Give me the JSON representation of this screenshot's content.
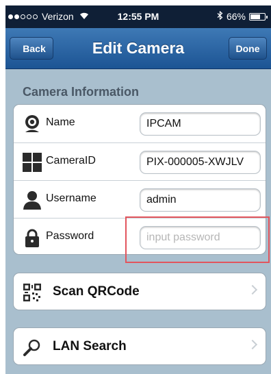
{
  "status_bar": {
    "carrier": "Verizon",
    "time": "12:55 PM",
    "battery": "66%",
    "signal_bars_filled": 2,
    "signal_bars_total": 5
  },
  "nav": {
    "back": "Back",
    "title": "Edit Camera",
    "done": "Done"
  },
  "section": {
    "title": "Camera Information"
  },
  "fields": {
    "name": {
      "label": "Name",
      "value": "IPCAM"
    },
    "camera_id": {
      "label": "CameraID",
      "value": "PIX-000005-XWJLV"
    },
    "username": {
      "label": "Username",
      "value": "admin"
    },
    "password": {
      "label": "Password",
      "value": "",
      "placeholder": "input password"
    }
  },
  "buttons": {
    "scan_qrcode": "Scan QRCode",
    "lan_search": "LAN Search"
  },
  "icons": {
    "name": "webcam-icon",
    "camera_id": "grid-icon",
    "username": "user-icon",
    "password": "lock-icon",
    "scan_qrcode": "qrcode-icon",
    "lan_search": "magnifier-icon"
  },
  "colors": {
    "nav_bar": "#2a64a4",
    "background": "#a9bfce",
    "highlight": "#e2555d"
  }
}
